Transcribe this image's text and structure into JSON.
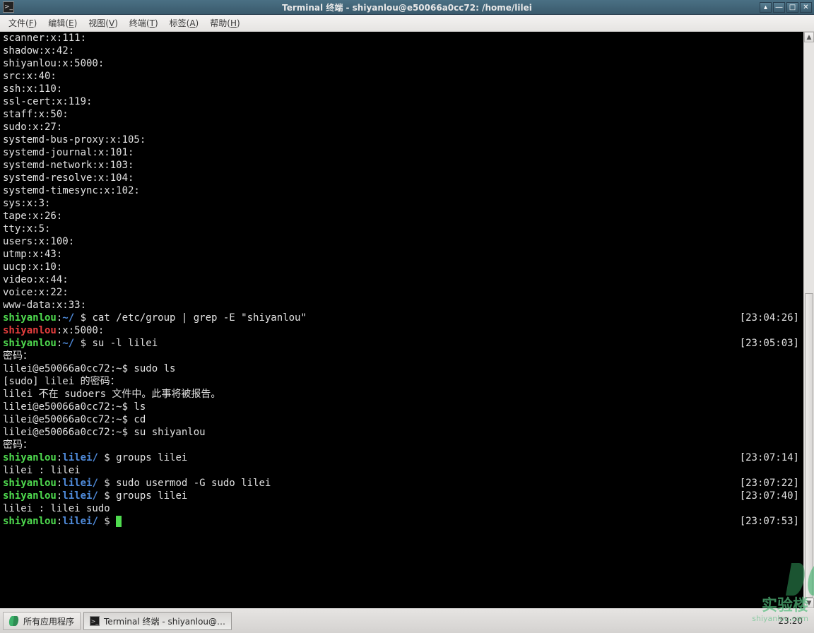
{
  "window": {
    "title": "Terminal 终端 - shiyanlou@e50066a0cc72: /home/lilei"
  },
  "menubar": {
    "file": "文件",
    "file_k": "F",
    "edit": "编辑",
    "edit_k": "E",
    "view": "视图",
    "view_k": "V",
    "term": "终端",
    "term_k": "T",
    "tabs": "标签",
    "tabs_k": "A",
    "help": "帮助",
    "help_k": "H"
  },
  "output": [
    "scanner:x:111:",
    "shadow:x:42:",
    "shiyanlou:x:5000:",
    "src:x:40:",
    "ssh:x:110:",
    "ssl-cert:x:119:",
    "staff:x:50:",
    "sudo:x:27:",
    "systemd-bus-proxy:x:105:",
    "systemd-journal:x:101:",
    "systemd-network:x:103:",
    "systemd-resolve:x:104:",
    "systemd-timesync:x:102:",
    "sys:x:3:",
    "tape:x:26:",
    "tty:x:5:",
    "users:x:100:",
    "utmp:x:43:",
    "uucp:x:10:",
    "video:x:44:",
    "voice:x:22:",
    "www-data:x:33:"
  ],
  "prompts": [
    {
      "user": "shiyanlou",
      "sep": ":",
      "path": "~/",
      "cmd": "cat /etc/group | grep -E \"shiyanlou\"",
      "ts": "[23:04:26]"
    },
    {
      "raw_red": "shiyanlou",
      "raw_tail": ":x:5000:"
    },
    {
      "user": "shiyanlou",
      "sep": ":",
      "path": "~/",
      "cmd": "su -l lilei",
      "ts": "[23:05:03]"
    },
    {
      "plain": "密码："
    },
    {
      "plain": "lilei@e50066a0cc72:~$ sudo ls"
    },
    {
      "plain": "[sudo] lilei 的密码："
    },
    {
      "plain": "lilei 不在 sudoers 文件中。此事将被报告。"
    },
    {
      "plain": "lilei@e50066a0cc72:~$ ls"
    },
    {
      "plain": "lilei@e50066a0cc72:~$ cd"
    },
    {
      "plain": "lilei@e50066a0cc72:~$ su shiyanlou"
    },
    {
      "plain": "密码："
    },
    {
      "user": "shiyanlou",
      "sep": ":",
      "path": "lilei/",
      "cmd": "groups lilei",
      "ts": "[23:07:14]"
    },
    {
      "plain": "lilei : lilei"
    },
    {
      "user": "shiyanlou",
      "sep": ":",
      "path": "lilei/",
      "cmd": "sudo usermod -G sudo lilei",
      "ts": "[23:07:22]"
    },
    {
      "user": "shiyanlou",
      "sep": ":",
      "path": "lilei/",
      "cmd": "groups lilei",
      "ts": "[23:07:40]"
    },
    {
      "plain": "lilei : lilei sudo"
    },
    {
      "user": "shiyanlou",
      "sep": ":",
      "path": "lilei/",
      "cmd": "",
      "ts": "[23:07:53]",
      "cursor": true
    }
  ],
  "taskbar": {
    "apps": "所有应用程序",
    "task1": "Terminal 终端 - shiyanlou@…",
    "clock": "23:20"
  },
  "watermark": {
    "text": "实验楼",
    "sub": "shiyanlou.com"
  }
}
